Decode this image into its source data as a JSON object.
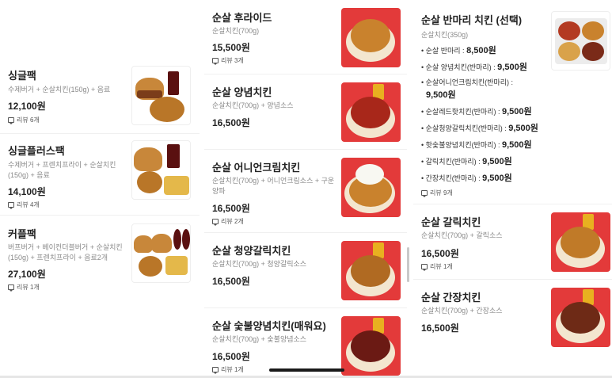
{
  "left_menu": [
    {
      "name": "싱글팩",
      "desc": "수제버거 + 순살치킨(150g) + 음료",
      "price": "12,100원",
      "reviews": "리뷰 6개",
      "image": "burger-chicken-cola-photo"
    },
    {
      "name": "싱글플러스팩",
      "desc": "수제버거 + 프렌치프라이 + 순살치킨(150g) + 음료",
      "price": "14,100원",
      "reviews": "리뷰 4개",
      "image": "burger-fries-chicken-photo"
    },
    {
      "name": "커플팩",
      "desc": "버프버거 + 베이컨더블버거 + 순살치킨(150g) + 프렌치프라이 + 음료2개",
      "price": "27,100원",
      "reviews": "리뷰 1개",
      "image": "couple-set-photo"
    }
  ],
  "middle_menu": [
    {
      "name": "순살 후라이드",
      "desc": "순살치킨(700g)",
      "price": "15,500원",
      "reviews": "리뷰 3개",
      "image": "fried-chicken-photo"
    },
    {
      "name": "순살 양념치킨",
      "desc": "순살치킨(700g) + 양념소스",
      "price": "16,500원",
      "reviews": "",
      "image": "sauce-chicken-photo"
    },
    {
      "name": "순살 어니언크림치킨",
      "desc": "순살치킨(700g) + 어니언크림소스 + 구운양파",
      "price": "16,500원",
      "reviews": "리뷰 2개",
      "image": "onion-cream-chicken-photo"
    },
    {
      "name": "순살 청양갈릭치킨",
      "desc": "순살치킨(700g) + 청양갈릭소스",
      "price": "16,500원",
      "reviews": "",
      "image": "garlic-chicken-photo"
    },
    {
      "name": "순살 숯불양념치킨(매워요)",
      "desc": "순살치킨(700g) + 숯불양념소스",
      "price": "16,500원",
      "reviews": "리뷰 1개",
      "image": "charcoal-chicken-photo"
    }
  ],
  "right_menu": {
    "half": {
      "name": "순살 반마리 치킨 (선택)",
      "desc": "순살치킨(350g)",
      "options": [
        {
          "label": "• 순살 반마리 : ",
          "price": "8,500원"
        },
        {
          "label": "• 순살 양념치킨(반마리) : ",
          "price": "9,500원"
        },
        {
          "label": "• 순살어니언크림치킨(반마리) :",
          "price": "9,500원"
        },
        {
          "label": "• 순살레드핫치킨(반마리) : ",
          "price": "9,500원"
        },
        {
          "label": "• 순살청양갈릭치킨(반마리) : ",
          "price": "9,500원"
        },
        {
          "label": "• 핫숯불양념치킨(반마리) : ",
          "price": "9,500원"
        },
        {
          "label": "• 갈릭치킨(반마리) : ",
          "price": "9,500원"
        },
        {
          "label": "• 간장치킨(반마리) : ",
          "price": "9,500원"
        }
      ],
      "reviews": "리뷰 9개",
      "image": "half-chicken-tray-photo"
    },
    "others": [
      {
        "name": "순살 갈릭치킨",
        "desc": "순살치킨(700g) + 갈릭소스",
        "price": "16,500원",
        "reviews": "리뷰 1개",
        "image": "garlic-sauce-chicken-photo"
      },
      {
        "name": "순살 간장치킨",
        "desc": "순살치킨(700g) + 간장소스",
        "price": "16,500원",
        "reviews": "",
        "image": "soy-chicken-photo"
      }
    ]
  },
  "colors": {
    "photo_bg_red": "#e33a3a",
    "text_dark": "#222222",
    "text_gray": "#8a8a8a"
  }
}
